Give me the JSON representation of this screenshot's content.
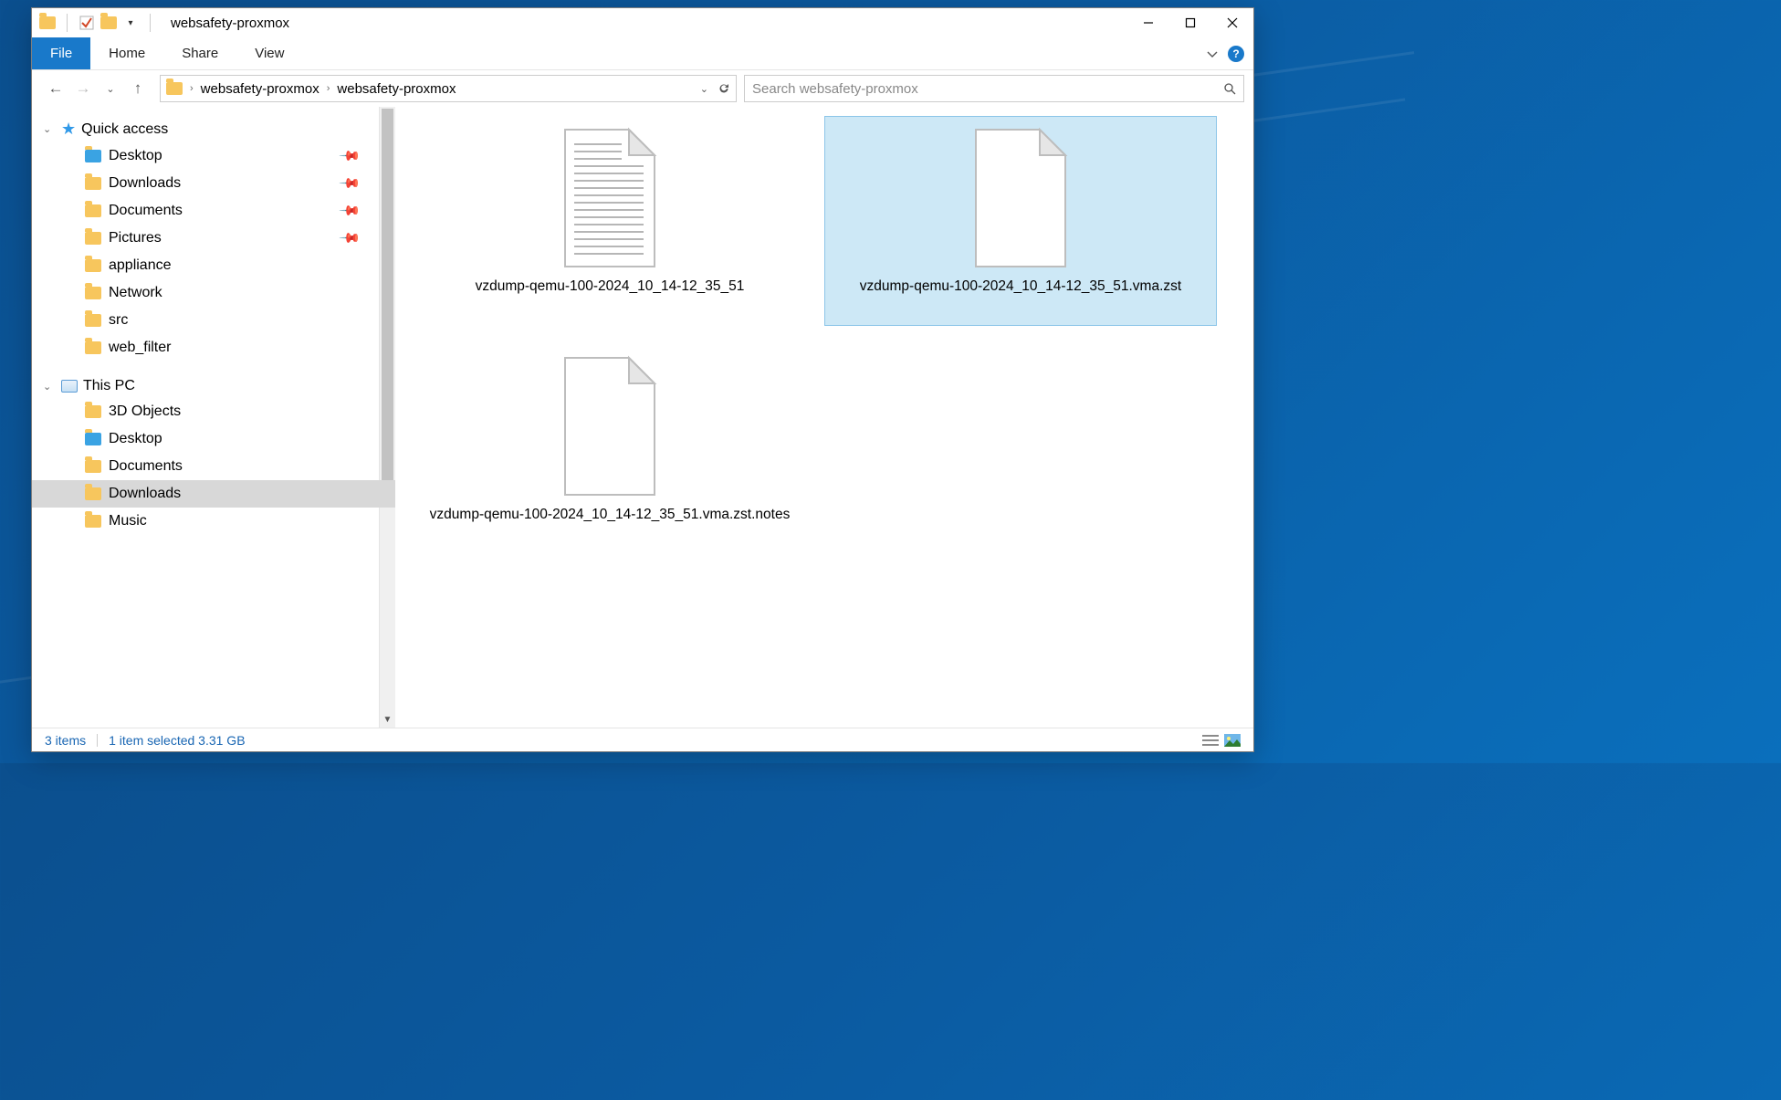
{
  "window": {
    "title": "websafety-proxmox"
  },
  "ribbon": {
    "file": "File",
    "home": "Home",
    "share": "Share",
    "view": "View"
  },
  "breadcrumb": {
    "level1": "websafety-proxmox",
    "level2": "websafety-proxmox"
  },
  "search": {
    "placeholder": "Search websafety-proxmox"
  },
  "nav": {
    "quick_access": "Quick access",
    "desktop": "Desktop",
    "downloads": "Downloads",
    "documents": "Documents",
    "pictures": "Pictures",
    "appliance": "appliance",
    "network": "Network",
    "src": "src",
    "web_filter": "web_filter",
    "this_pc": "This PC",
    "pc_3d": "3D Objects",
    "pc_desktop": "Desktop",
    "pc_documents": "Documents",
    "pc_downloads": "Downloads",
    "pc_music": "Music"
  },
  "files": [
    {
      "name": "vzdump-qemu-100-2024_10_14-12_35_51",
      "kind": "text",
      "selected": false
    },
    {
      "name": "vzdump-qemu-100-2024_10_14-12_35_51.vma.zst",
      "kind": "blank",
      "selected": true
    },
    {
      "name": "vzdump-qemu-100-2024_10_14-12_35_51.vma.zst.notes",
      "kind": "blank",
      "selected": false
    }
  ],
  "status": {
    "items": "3 items",
    "selection": "1 item selected  3.31 GB"
  }
}
